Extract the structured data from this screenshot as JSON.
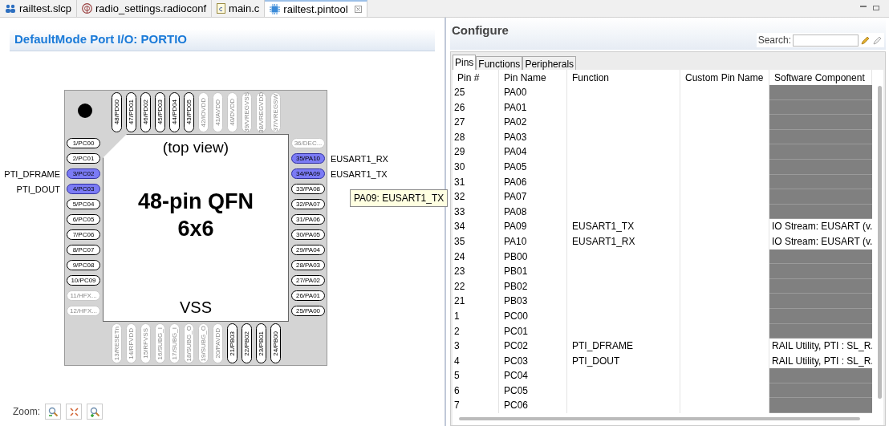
{
  "editor_tabs": [
    {
      "label": "railtest.slcp",
      "kind": "project",
      "selected": false,
      "closable": false
    },
    {
      "label": "radio_settings.radioconf",
      "kind": "radio",
      "selected": false,
      "closable": false
    },
    {
      "label": "main.c",
      "kind": "c-file",
      "selected": false,
      "closable": false
    },
    {
      "label": "railtest.pintool",
      "kind": "pintool",
      "selected": true,
      "closable": true
    }
  ],
  "left_panel": {
    "title": "DefaultMode Port I/O: PORTIO",
    "chip": {
      "top_view_label": "(top view)",
      "package": "48-pin QFN",
      "size": "6x6",
      "center_label": "VSS",
      "top": [
        {
          "label": "48/PD00",
          "selected": false,
          "disabled": false
        },
        {
          "label": "47/PD01",
          "selected": false,
          "disabled": false
        },
        {
          "label": "46/PD02",
          "selected": false,
          "disabled": false
        },
        {
          "label": "45/PD03",
          "selected": false,
          "disabled": false
        },
        {
          "label": "44/PD04",
          "selected": false,
          "disabled": false
        },
        {
          "label": "43/PD05",
          "selected": false,
          "disabled": false
        },
        {
          "label": "42/IOVDD",
          "selected": false,
          "disabled": true
        },
        {
          "label": "41/AVDD",
          "selected": false,
          "disabled": true
        },
        {
          "label": "40/DVDD",
          "selected": false,
          "disabled": true
        },
        {
          "label": "39/VREGVSS",
          "selected": false,
          "disabled": true
        },
        {
          "label": "38/VREGVDD",
          "selected": false,
          "disabled": true
        },
        {
          "label": "37/VREGSW",
          "selected": false,
          "disabled": true
        }
      ],
      "left": [
        {
          "label": "1/PC00",
          "selected": false,
          "disabled": false
        },
        {
          "label": "2/PC01",
          "selected": false,
          "disabled": false
        },
        {
          "label": "3/PC02",
          "selected": true,
          "disabled": false,
          "signal": "PTI_DFRAME"
        },
        {
          "label": "4/PC03",
          "selected": true,
          "disabled": false,
          "signal": "PTI_DOUT"
        },
        {
          "label": "5/PC04",
          "selected": false,
          "disabled": false
        },
        {
          "label": "6/PC05",
          "selected": false,
          "disabled": false
        },
        {
          "label": "7/PC06",
          "selected": false,
          "disabled": false
        },
        {
          "label": "8/PC07",
          "selected": false,
          "disabled": false
        },
        {
          "label": "9/PC08",
          "selected": false,
          "disabled": false
        },
        {
          "label": "10/PC09",
          "selected": false,
          "disabled": false
        },
        {
          "label": "11/HFX...",
          "selected": false,
          "disabled": true
        },
        {
          "label": "12/HFX...",
          "selected": false,
          "disabled": true
        }
      ],
      "right": [
        {
          "label": "36/DEC...",
          "selected": false,
          "disabled": true
        },
        {
          "label": "35/PA10",
          "selected": true,
          "disabled": false,
          "signal": "EUSART1_RX"
        },
        {
          "label": "34/PA09",
          "selected": true,
          "disabled": false,
          "signal": "EUSART1_TX"
        },
        {
          "label": "33/PA08",
          "selected": false,
          "disabled": false
        },
        {
          "label": "32/PA07",
          "selected": false,
          "disabled": false
        },
        {
          "label": "31/PA06",
          "selected": false,
          "disabled": false
        },
        {
          "label": "30/PA05",
          "selected": false,
          "disabled": false
        },
        {
          "label": "29/PA04",
          "selected": false,
          "disabled": false
        },
        {
          "label": "28/PA03",
          "selected": false,
          "disabled": false
        },
        {
          "label": "27/PA02",
          "selected": false,
          "disabled": false
        },
        {
          "label": "26/PA01",
          "selected": false,
          "disabled": false
        },
        {
          "label": "25/PA00",
          "selected": false,
          "disabled": false
        }
      ],
      "bottom": [
        {
          "label": "13/RESETn",
          "selected": false,
          "disabled": true
        },
        {
          "label": "14/RFVDD",
          "selected": false,
          "disabled": true
        },
        {
          "label": "15/RFVSS",
          "selected": false,
          "disabled": true
        },
        {
          "label": "16/SUBG_I",
          "selected": false,
          "disabled": true
        },
        {
          "label": "17/SUBG_I",
          "selected": false,
          "disabled": true
        },
        {
          "label": "18/SUBG_O",
          "selected": false,
          "disabled": true
        },
        {
          "label": "19/SUBG_O",
          "selected": false,
          "disabled": true
        },
        {
          "label": "20/PAVDD",
          "selected": false,
          "disabled": true
        },
        {
          "label": "21/PB03",
          "selected": false,
          "disabled": false
        },
        {
          "label": "22/PB02",
          "selected": false,
          "disabled": false
        },
        {
          "label": "23/PB01",
          "selected": false,
          "disabled": false
        },
        {
          "label": "24/PB00",
          "selected": false,
          "disabled": false
        }
      ]
    },
    "tooltip": "PA09: EUSART1_TX",
    "zoom_label": "Zoom:"
  },
  "configure": {
    "title": "Configure",
    "search_label": "Search:",
    "tabs": [
      {
        "label": "Pins",
        "selected": true
      },
      {
        "label": "Functions",
        "selected": false
      },
      {
        "label": "Peripherals",
        "selected": false
      }
    ],
    "columns": [
      "Pin #",
      "Pin Name",
      "Function",
      "Custom Pin Name",
      "Software Component"
    ],
    "rows": [
      {
        "pin": "25",
        "name": "PA00",
        "assigned": false
      },
      {
        "pin": "26",
        "name": "PA01",
        "assigned": false
      },
      {
        "pin": "27",
        "name": "PA02",
        "assigned": false
      },
      {
        "pin": "28",
        "name": "PA03",
        "assigned": false
      },
      {
        "pin": "29",
        "name": "PA04",
        "assigned": false
      },
      {
        "pin": "30",
        "name": "PA05",
        "assigned": false
      },
      {
        "pin": "31",
        "name": "PA06",
        "assigned": false
      },
      {
        "pin": "32",
        "name": "PA07",
        "assigned": false
      },
      {
        "pin": "33",
        "name": "PA08",
        "assigned": false
      },
      {
        "pin": "34",
        "name": "PA09",
        "function": "EUSART1_TX",
        "component": "IO Stream: EUSART (v.",
        "assigned": true
      },
      {
        "pin": "35",
        "name": "PA10",
        "function": "EUSART1_RX",
        "component": "IO Stream: EUSART (v.",
        "assigned": true
      },
      {
        "pin": "24",
        "name": "PB00",
        "assigned": false
      },
      {
        "pin": "23",
        "name": "PB01",
        "assigned": false
      },
      {
        "pin": "22",
        "name": "PB02",
        "assigned": false
      },
      {
        "pin": "21",
        "name": "PB03",
        "assigned": false
      },
      {
        "pin": "1",
        "name": "PC00",
        "assigned": false
      },
      {
        "pin": "2",
        "name": "PC01",
        "assigned": false
      },
      {
        "pin": "3",
        "name": "PC02",
        "function": "PTI_DFRAME",
        "component": "RAIL Utility, PTI : SL_R.",
        "assigned": true
      },
      {
        "pin": "4",
        "name": "PC03",
        "function": "PTI_DOUT",
        "component": "RAIL Utility, PTI : SL_R.",
        "assigned": true
      },
      {
        "pin": "5",
        "name": "PC04",
        "assigned": false
      },
      {
        "pin": "6",
        "name": "PC05",
        "assigned": false
      },
      {
        "pin": "7",
        "name": "PC06",
        "assigned": false
      }
    ]
  }
}
